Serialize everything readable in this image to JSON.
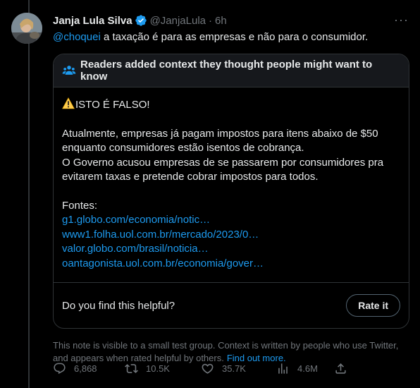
{
  "tweet": {
    "author_name": "Janja Lula Silva",
    "handle": "@JanjaLula",
    "separator": "·",
    "time": "6h",
    "mention": "@choquei",
    "text": " a taxação é para as empresas e não para o consumidor."
  },
  "note": {
    "header": "Readers added context they thought people might want to know",
    "warning": "ISTO É FALSO!",
    "paragraph1": "Atualmente, empresas já pagam impostos para itens abaixo de $50 enquanto consumidores estão isentos de cobrança.",
    "paragraph2": "O Governo acusou empresas de se passarem por consumidores pra evitarem taxas e pretende cobrar impostos para todos.",
    "sources_label": "Fontes:",
    "sources": [
      "g1.globo.com/economia/notic…",
      "www1.folha.uol.com.br/mercado/2023/0…",
      "valor.globo.com/brasil/noticia…",
      "oantagonista.uol.com.br/economia/gover…"
    ],
    "helpful_question": "Do you find this helpful?",
    "rate_button": "Rate it"
  },
  "footnote": {
    "text": "This note is visible to a small test group. Context is written by people who use Twitter, and appears when rated helpful by others.",
    "link": "Find out more."
  },
  "actions": {
    "replies": "6,868",
    "retweets": "10.5K",
    "likes": "35.7K",
    "views": "4.6M"
  },
  "colors": {
    "background": "#000000",
    "text": "#e7e9ea",
    "muted": "#71767b",
    "link": "#1d9bf0",
    "border": "#2f3336"
  }
}
